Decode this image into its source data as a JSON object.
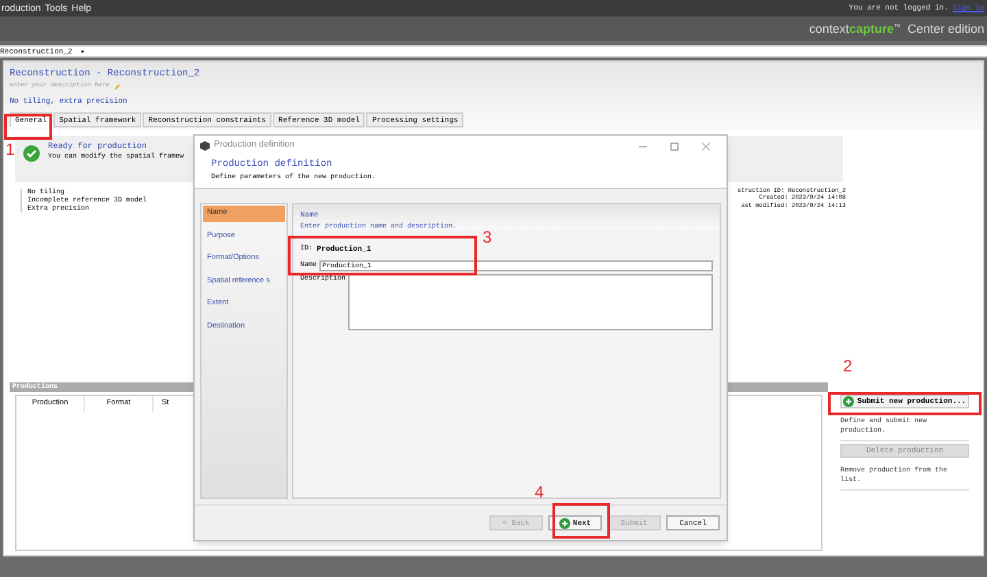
{
  "menu_bar": {
    "items": [
      "roduction",
      "Tools",
      "Help"
    ],
    "login_text": "You are not logged in.",
    "sign_in": "Sign in"
  },
  "brand": {
    "name_light": "context",
    "name_bold": "capture",
    "trademark": "™",
    "edition": "Center edition"
  },
  "breadcrumb": {
    "item": "Reconstruction_2",
    "arrow": "▸"
  },
  "reconstruction": {
    "title": "Reconstruction - Reconstruction_2",
    "description_placeholder": "enter your description here",
    "summary": "No tiling, extra precision"
  },
  "tabs": [
    {
      "label": "General",
      "selected": true
    },
    {
      "label": "Spatial framework",
      "selected": false
    },
    {
      "label": "Reconstruction constraints",
      "selected": false
    },
    {
      "label": "Reference 3D model",
      "selected": false
    },
    {
      "label": "Processing settings",
      "selected": false
    }
  ],
  "status": {
    "title": "Ready for production",
    "message": "You can modify the spatial framew"
  },
  "notes": [
    "No tiling",
    "Incomplete reference 3D model",
    "Extra precision"
  ],
  "info": [
    "struction ID: Reconstruction_2",
    "Created: 2023/9/24 14:08",
    "ast modified: 2023/9/24 14:13"
  ],
  "productions": {
    "title": "Productions",
    "columns": [
      "Production",
      "Format",
      "St"
    ]
  },
  "actions": [
    {
      "label": "Submit new production...",
      "description": "Define and submit new production.",
      "disabled": false
    },
    {
      "label": "Delete production",
      "description": "Remove production from the list.",
      "disabled": true
    }
  ],
  "dialog": {
    "title": "Production definition",
    "header_title": "Production definition",
    "header_subtitle": "Define parameters of the new production.",
    "steps": [
      {
        "label": "Name",
        "selected": true
      },
      {
        "label": "Purpose",
        "selected": false
      },
      {
        "label": "Format/Options",
        "selected": false
      },
      {
        "label": "Spatial reference s",
        "selected": false
      },
      {
        "label": "Extent",
        "selected": false
      },
      {
        "label": "Destination",
        "selected": false
      }
    ],
    "section_title": "Name",
    "section_subtitle": "Enter production name and description.",
    "id_label": "ID:",
    "id_value": "Production_1",
    "name_label": "Name",
    "name_value": "Production_1",
    "description_label": "Description",
    "buttons": [
      {
        "label": "< Back",
        "disabled": true,
        "icon": false
      },
      {
        "label": "Next",
        "disabled": false,
        "icon": true
      },
      {
        "label": "Submit",
        "disabled": true,
        "icon": false
      },
      {
        "label": "Cancel",
        "disabled": false,
        "icon": false
      }
    ]
  },
  "annotations": [
    {
      "label": "1"
    },
    {
      "label": "2"
    },
    {
      "label": "3"
    },
    {
      "label": "4"
    }
  ]
}
